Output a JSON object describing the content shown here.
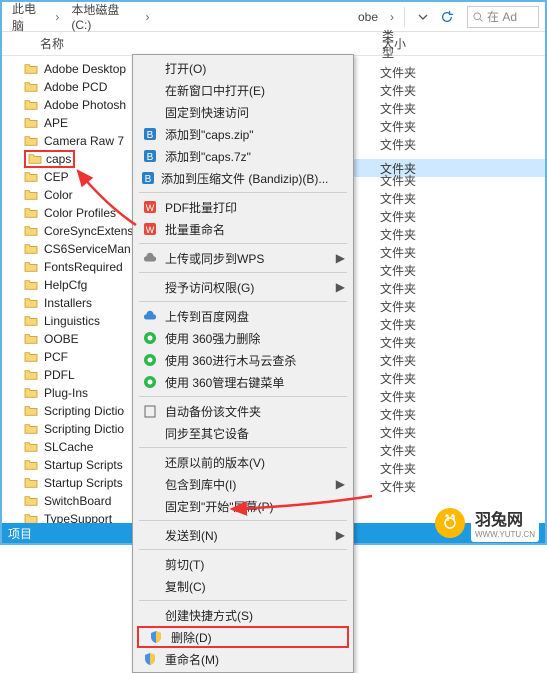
{
  "breadcrumb": {
    "c0": "此电脑",
    "c1": "本地磁盘 (C:)",
    "c_last": "obe",
    "search_prefix": "在 Ad"
  },
  "headers": {
    "name": "名称",
    "type": "类型",
    "size": "大小"
  },
  "folders": [
    {
      "label": "Adobe Desktop"
    },
    {
      "label": "Adobe PCD"
    },
    {
      "label": "Adobe Photosh"
    },
    {
      "label": "APE"
    },
    {
      "label": "Camera Raw 7"
    },
    {
      "label": "caps"
    },
    {
      "label": "CEP"
    },
    {
      "label": "Color"
    },
    {
      "label": "Color Profiles"
    },
    {
      "label": "CoreSyncExtens"
    },
    {
      "label": "CS6ServiceMan"
    },
    {
      "label": "FontsRequired"
    },
    {
      "label": "HelpCfg"
    },
    {
      "label": "Installers"
    },
    {
      "label": "Linguistics"
    },
    {
      "label": "OOBE"
    },
    {
      "label": "PCF"
    },
    {
      "label": "PDFL"
    },
    {
      "label": "Plug-Ins"
    },
    {
      "label": "Scripting Dictio"
    },
    {
      "label": "Scripting Dictio"
    },
    {
      "label": "SLCache"
    },
    {
      "label": "Startup Scripts"
    },
    {
      "label": "Startup Scripts"
    },
    {
      "label": "SwitchBoard"
    },
    {
      "label": "TypeSupport"
    }
  ],
  "type_label": "文件夹",
  "type_label_highlighted": "文件夹",
  "menu": {
    "open": "打开(O)",
    "open_new_window": "在新窗口中打开(E)",
    "pin_quick": "固定到快速访问",
    "add_caps_zip": "添加到\"caps.zip\"",
    "add_caps_7z": "添加到\"caps.7z\"",
    "add_archive": "添加到压缩文件 (Bandizip)(B)...",
    "pdf_batch": "PDF批量打印",
    "batch_rename": "批量重命名",
    "upload_wps": "上传或同步到WPS",
    "grant_access": "授予访问权限(G)",
    "upload_baidu": "上传到百度网盘",
    "del_360": "使用 360强力删除",
    "scan_360": "使用 360进行木马云查杀",
    "mgr_360": "使用 360管理右键菜单",
    "auto_backup": "自动备份该文件夹",
    "sync_other": "同步至其它设备",
    "restore_prev": "还原以前的版本(V)",
    "include_lib": "包含到库中(I)",
    "pin_start": "固定到\"开始\"屏幕(P)",
    "send_to": "发送到(N)",
    "cut": "剪切(T)",
    "copy": "复制(C)",
    "shortcut": "创建快捷方式(S)",
    "delete": "删除(D)",
    "rename": "重命名(M)"
  },
  "status": "项目",
  "footer": {
    "brand": "羽兔网",
    "url": "WWW.YUTU.CN"
  }
}
